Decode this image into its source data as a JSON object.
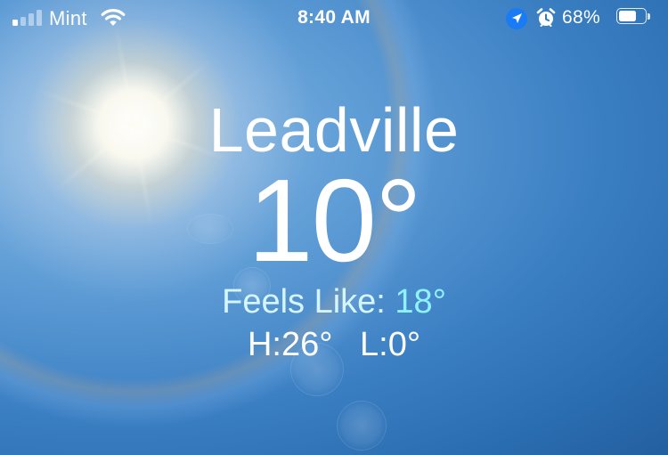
{
  "status_bar": {
    "carrier": "Mint",
    "time": "8:40 AM",
    "battery_percent_label": "68%",
    "battery_level": 0.68,
    "signal_bars_active": 1,
    "signal_bars_total": 4
  },
  "weather": {
    "city": "Leadville",
    "temperature": "10°",
    "feels_like_label": "Feels Like:",
    "feels_like_value": "18°",
    "high": "H:26°",
    "low": "L:0°"
  },
  "colors": {
    "sky_top": "#8fbde5",
    "sky_deep": "#235f9f",
    "feels_like_accent": "#8ff3ff",
    "text": "#ffffff"
  },
  "icons": {
    "signal": "cellular-signal-icon",
    "wifi": "wifi-icon",
    "location": "location-arrow-icon",
    "alarm": "alarm-clock-icon",
    "battery": "battery-icon"
  }
}
